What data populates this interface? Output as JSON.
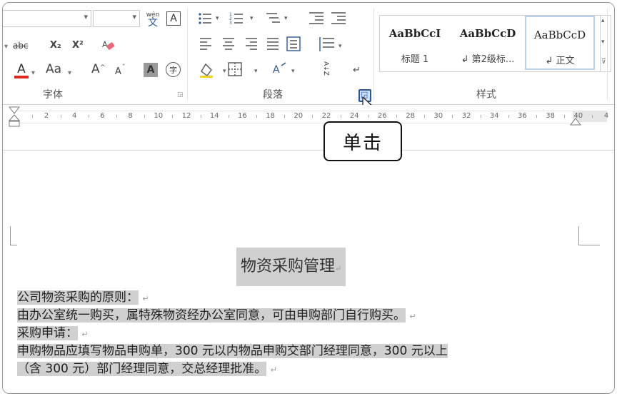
{
  "ribbon": {
    "font_group": {
      "label": "字体",
      "strikethrough": "abc",
      "subscript": "X₂",
      "superscript": "X²",
      "font_color_glyph": "A",
      "change_case": "Aa",
      "grow_font": "A",
      "shrink_font": "A",
      "char_shading_glyph": "A",
      "enclose_glyph": "字",
      "phonetic_top": "wén",
      "phonetic_bottom": "文",
      "char_border_glyph": "A"
    },
    "paragraph_group": {
      "label": "段落",
      "sort_glyph": "A↓Z"
    },
    "styles_group": {
      "label": "样式",
      "tiles": [
        {
          "sample": "AaBbCcI",
          "name": "标题 1"
        },
        {
          "sample": "AaBbCcD",
          "name": "↲ 第2级标..."
        },
        {
          "sample": "AaBbCcD",
          "name": "↲ 正文"
        }
      ]
    }
  },
  "ruler": {
    "ticks": [
      "2",
      "4",
      "6",
      "8",
      "10",
      "12",
      "14",
      "16",
      "18",
      "20",
      "22",
      "24",
      "26",
      "28",
      "30",
      "32",
      "34",
      "36",
      "38",
      "40",
      "4"
    ]
  },
  "callout": {
    "text": "单击"
  },
  "document": {
    "title": "物资采购管理",
    "lines": [
      "公司物资采购的原则：",
      "由办公室统一购买，属特殊物资经办公室同意，可由申购部门自行购买。",
      "采购申请：",
      "申购物品应填写物品申购单，300 元以内物品申购交部门经理同意，300 元以上",
      "（含 300 元）部门经理同意，交总经理批准。"
    ],
    "para_mark": "↵"
  },
  "colors": {
    "font_color_bar": "#e0281e",
    "selection": "#d0d0d0",
    "highlight_border": "#2b579a"
  }
}
